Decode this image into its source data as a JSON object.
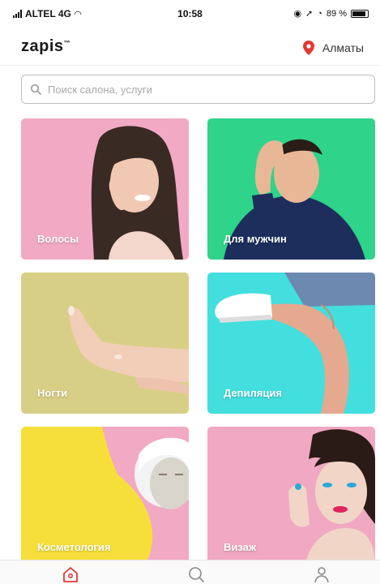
{
  "status_bar": {
    "carrier": "ALTEL 4G",
    "time": "10:58",
    "battery_text": "89 %",
    "battery_level": 0.89
  },
  "header": {
    "logo": "zapis",
    "city": "Алматы",
    "accent_color": "#e53935"
  },
  "search": {
    "placeholder": "Поиск салона, услуги"
  },
  "categories": [
    {
      "label": "Волосы",
      "bg": "#f2a9c4"
    },
    {
      "label": "Для мужчин",
      "bg": "#2fd38a"
    },
    {
      "label": "Ногти",
      "bg": "#d8cf86"
    },
    {
      "label": "Депиляция",
      "bg": "#43dede"
    },
    {
      "label": "Косметология",
      "bg": "#f7df3b"
    },
    {
      "label": "Визаж",
      "bg": "#f1a8c2"
    }
  ],
  "tabbar": {
    "items": [
      "home-icon",
      "search-icon",
      "profile-icon"
    ],
    "active": "home-icon",
    "active_color": "#e53935"
  }
}
